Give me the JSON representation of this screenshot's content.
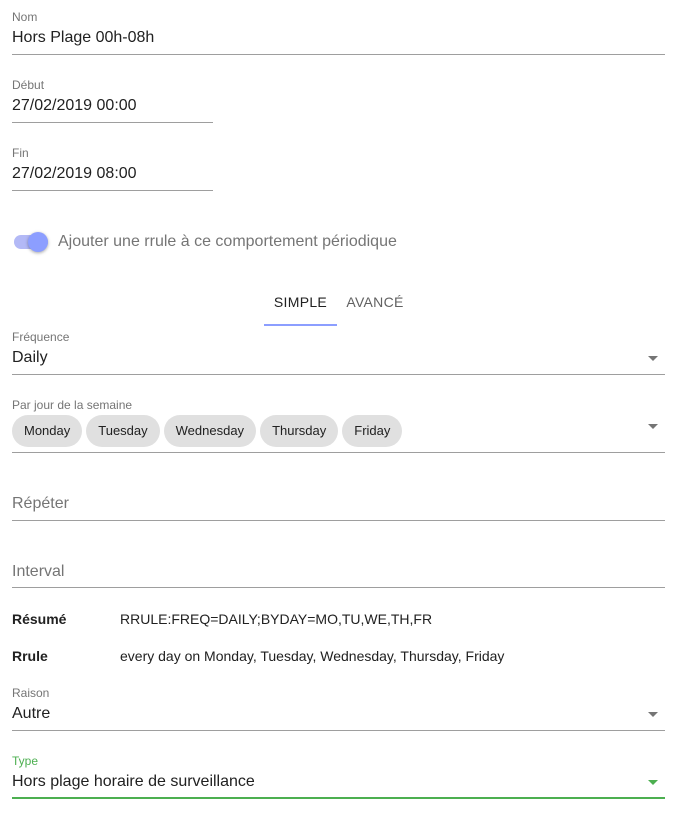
{
  "nom": {
    "label": "Nom",
    "value": "Hors Plage 00h-08h"
  },
  "debut": {
    "label": "Début",
    "value": "27/02/2019 00:00"
  },
  "fin": {
    "label": "Fin",
    "value": "27/02/2019 08:00"
  },
  "rrule_toggle": {
    "label": "Ajouter une rrule à ce comportement périodique",
    "checked": true
  },
  "tabs": [
    {
      "label": "SIMPLE",
      "active": true
    },
    {
      "label": "AVANCÉ",
      "active": false
    }
  ],
  "frequence": {
    "label": "Fréquence",
    "value": "Daily"
  },
  "par_jour": {
    "label": "Par jour de la semaine",
    "chips": [
      "Monday",
      "Tuesday",
      "Wednesday",
      "Thursday",
      "Friday"
    ]
  },
  "repeter": {
    "placeholder": "Répéter"
  },
  "interval": {
    "placeholder": "Interval"
  },
  "summary": {
    "resume_label": "Résumé",
    "resume_value": "RRULE:FREQ=DAILY;BYDAY=MO,TU,WE,TH,FR",
    "rrule_label": "Rrule",
    "rrule_value": "every day on Monday, Tuesday, Wednesday, Thursday, Friday"
  },
  "raison": {
    "label": "Raison",
    "value": "Autre"
  },
  "type": {
    "label": "Type",
    "value": "Hors plage horaire de surveillance"
  },
  "colors": {
    "accent": "#8c9eff",
    "focus_green": "#4caf50",
    "chip_bg": "#e0e0e0"
  },
  "icons": {
    "dropdown": "caret-down-icon"
  }
}
